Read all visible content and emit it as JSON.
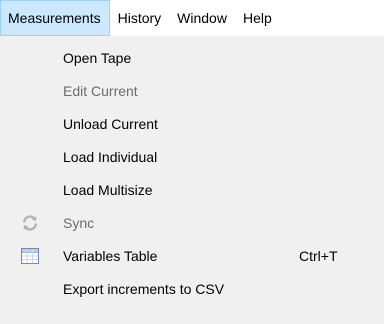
{
  "menubar": {
    "items": [
      {
        "label": "Measurements"
      },
      {
        "label": "History"
      },
      {
        "label": "Window"
      },
      {
        "label": "Help"
      }
    ]
  },
  "menu": {
    "items": [
      {
        "label": "Open Tape",
        "enabled": true
      },
      {
        "label": "Edit Current",
        "enabled": false
      },
      {
        "label": "Unload Current",
        "enabled": true
      },
      {
        "label": "Load Individual",
        "enabled": true
      },
      {
        "label": "Load Multisize",
        "enabled": true
      },
      {
        "label": "Sync",
        "enabled": false,
        "icon": "sync-icon"
      },
      {
        "label": "Variables Table",
        "enabled": true,
        "icon": "table-icon",
        "shortcut": "Ctrl+T"
      },
      {
        "label": "Export increments to CSV",
        "enabled": true
      }
    ]
  },
  "colors": {
    "active_menu_bg": "#cce8ff",
    "active_menu_border": "#99d1ff",
    "disabled_text": "#6d6d6d"
  }
}
